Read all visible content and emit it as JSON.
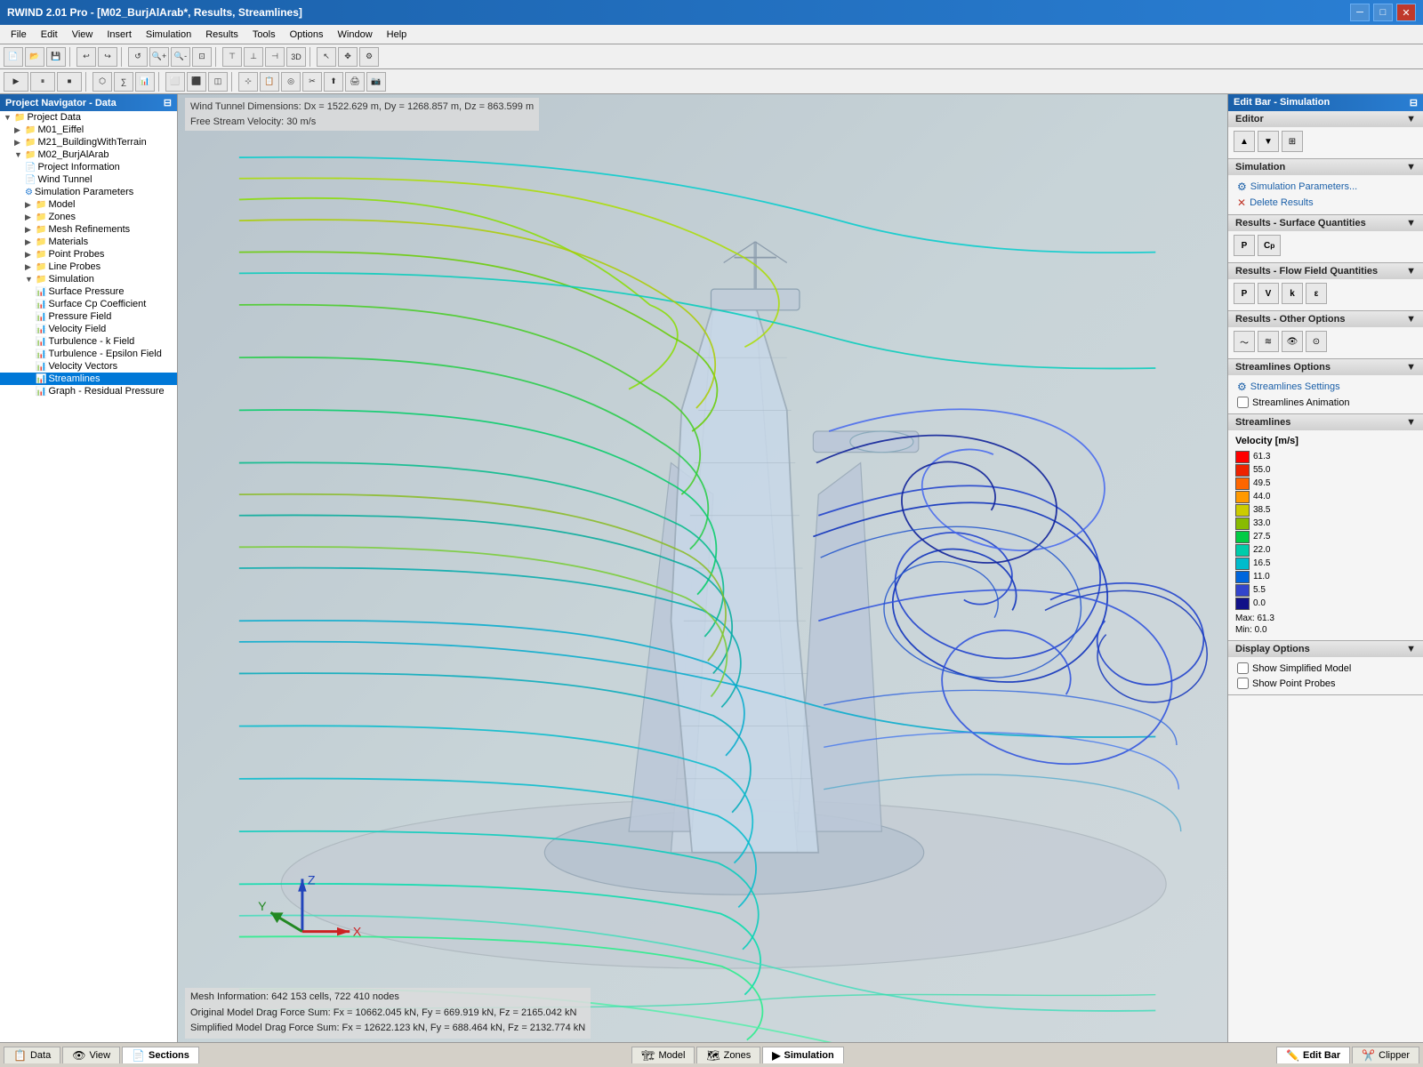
{
  "titlebar": {
    "title": "RWIND 2.01 Pro - [M02_BurjAlArab*, Results, Streamlines]"
  },
  "menu": {
    "items": [
      "File",
      "Edit",
      "View",
      "Insert",
      "Simulation",
      "Results",
      "Tools",
      "Options",
      "Window",
      "Help"
    ]
  },
  "nav": {
    "title": "Project Navigator - Data",
    "tree": [
      {
        "id": "project-data",
        "label": "Project Data",
        "level": 0,
        "type": "folder",
        "expanded": true
      },
      {
        "id": "m01-eiffel",
        "label": "M01_Eiffel",
        "level": 1,
        "type": "folder",
        "expanded": false
      },
      {
        "id": "m21-building",
        "label": "M21_BuildingWithTerrain",
        "level": 1,
        "type": "folder",
        "expanded": false
      },
      {
        "id": "m02-burj",
        "label": "M02_BurjAlArab",
        "level": 1,
        "type": "folder",
        "expanded": true
      },
      {
        "id": "project-info",
        "label": "Project Information",
        "level": 2,
        "type": "info"
      },
      {
        "id": "wind-tunnel",
        "label": "Wind Tunnel",
        "level": 2,
        "type": "info"
      },
      {
        "id": "sim-params",
        "label": "Simulation Parameters",
        "level": 2,
        "type": "sim"
      },
      {
        "id": "model",
        "label": "Model",
        "level": 2,
        "type": "folder"
      },
      {
        "id": "zones",
        "label": "Zones",
        "level": 2,
        "type": "folder"
      },
      {
        "id": "mesh-refinements",
        "label": "Mesh Refinements",
        "level": 2,
        "type": "folder"
      },
      {
        "id": "materials",
        "label": "Materials",
        "level": 2,
        "type": "folder"
      },
      {
        "id": "point-probes",
        "label": "Point Probes",
        "level": 2,
        "type": "folder"
      },
      {
        "id": "line-probes",
        "label": "Line Probes",
        "level": 2,
        "type": "folder"
      },
      {
        "id": "simulation",
        "label": "Simulation",
        "level": 2,
        "type": "folder",
        "expanded": true
      },
      {
        "id": "surface-pressure",
        "label": "Surface Pressure",
        "level": 3,
        "type": "results"
      },
      {
        "id": "surface-cp",
        "label": "Surface Cp Coefficient",
        "level": 3,
        "type": "results"
      },
      {
        "id": "pressure-field",
        "label": "Pressure Field",
        "level": 3,
        "type": "results"
      },
      {
        "id": "velocity-field",
        "label": "Velocity Field",
        "level": 3,
        "type": "results"
      },
      {
        "id": "turbulence-k",
        "label": "Turbulence - k Field",
        "level": 3,
        "type": "results"
      },
      {
        "id": "turbulence-eps",
        "label": "Turbulence - Epsilon Field",
        "level": 3,
        "type": "results"
      },
      {
        "id": "velocity-vectors",
        "label": "Velocity Vectors",
        "level": 3,
        "type": "results"
      },
      {
        "id": "streamlines",
        "label": "Streamlines",
        "level": 3,
        "type": "results",
        "selected": true
      },
      {
        "id": "graph-residual",
        "label": "Graph - Residual Pressure",
        "level": 3,
        "type": "results"
      }
    ]
  },
  "viewport": {
    "info_top_line1": "Wind Tunnel Dimensions: Dx = 1522.629 m, Dy = 1268.857 m, Dz = 863.599 m",
    "info_top_line2": "Free Stream Velocity: 30 m/s",
    "info_bottom_line1": "Mesh Information: 642 153 cells, 722 410 nodes",
    "info_bottom_line2": "Original Model Drag Force Sum: Fx = 10662.045 kN, Fy = 669.919 kN, Fz = 2165.042 kN",
    "info_bottom_line3": "Simplified Model Drag Force Sum: Fx = 12622.123 kN, Fy = 688.464 kN, Fz = 2132.774 kN"
  },
  "editbar": {
    "title": "Edit Bar - Simulation",
    "editor_label": "Editor",
    "simulation_label": "Simulation",
    "sim_params_link": "Simulation Parameters...",
    "delete_results_link": "Delete Results",
    "surface_quantities_label": "Results - Surface Quantities",
    "surface_btns": [
      "P",
      "Cp"
    ],
    "flow_field_label": "Results - Flow Field Quantities",
    "flow_btns": [
      "P",
      "V",
      "k",
      "ε"
    ],
    "other_options_label": "Results - Other Options",
    "other_btns": [
      "streams1",
      "streams2",
      "eye1",
      "eye2"
    ],
    "streamlines_options_label": "Streamlines Options",
    "streamlines_settings": "Streamlines Settings",
    "streamlines_animation": "Streamlines Animation",
    "streamlines_section_label": "Streamlines",
    "legend_title": "Velocity [m/s]",
    "legend_entries": [
      {
        "color": "#ff0000",
        "value": "61.3"
      },
      {
        "color": "#ee1100",
        "value": "55.0"
      },
      {
        "color": "#ff6600",
        "value": "49.5"
      },
      {
        "color": "#ff9900",
        "value": "44.0"
      },
      {
        "color": "#cccc00",
        "value": "38.5"
      },
      {
        "color": "#88bb00",
        "value": "33.0"
      },
      {
        "color": "#00cc44",
        "value": "27.5"
      },
      {
        "color": "#00ccaa",
        "value": "22.0"
      },
      {
        "color": "#00bbcc",
        "value": "16.5"
      },
      {
        "color": "#0088dd",
        "value": "11.0"
      },
      {
        "color": "#3355ff",
        "value": "5.5"
      },
      {
        "color": "#1a1a99",
        "value": "0.0"
      }
    ],
    "legend_max": "Max:  61.3",
    "legend_min": "Min:  0.0",
    "display_options_label": "Display Options",
    "show_simplified": "Show Simplified Model",
    "show_point_probes": "Show Point Probes"
  },
  "bottom_left_tabs": [
    {
      "id": "data",
      "label": "Data",
      "icon": "📋",
      "active": false
    },
    {
      "id": "view",
      "label": "View",
      "icon": "👁",
      "active": false
    },
    {
      "id": "sections",
      "label": "Sections",
      "icon": "📄",
      "active": true
    }
  ],
  "bottom_right_tabs": [
    {
      "id": "editbar",
      "label": "Edit Bar",
      "icon": "✏️",
      "active": true
    },
    {
      "id": "clipper",
      "label": "Clipper",
      "icon": "✂️",
      "active": false
    }
  ],
  "bottom_center_tabs": [
    {
      "id": "model",
      "label": "Model",
      "icon": "🏗",
      "active": false
    },
    {
      "id": "zones",
      "label": "Zones",
      "icon": "🗺",
      "active": false
    },
    {
      "id": "simulation",
      "label": "Simulation",
      "icon": "▶",
      "active": true
    }
  ]
}
